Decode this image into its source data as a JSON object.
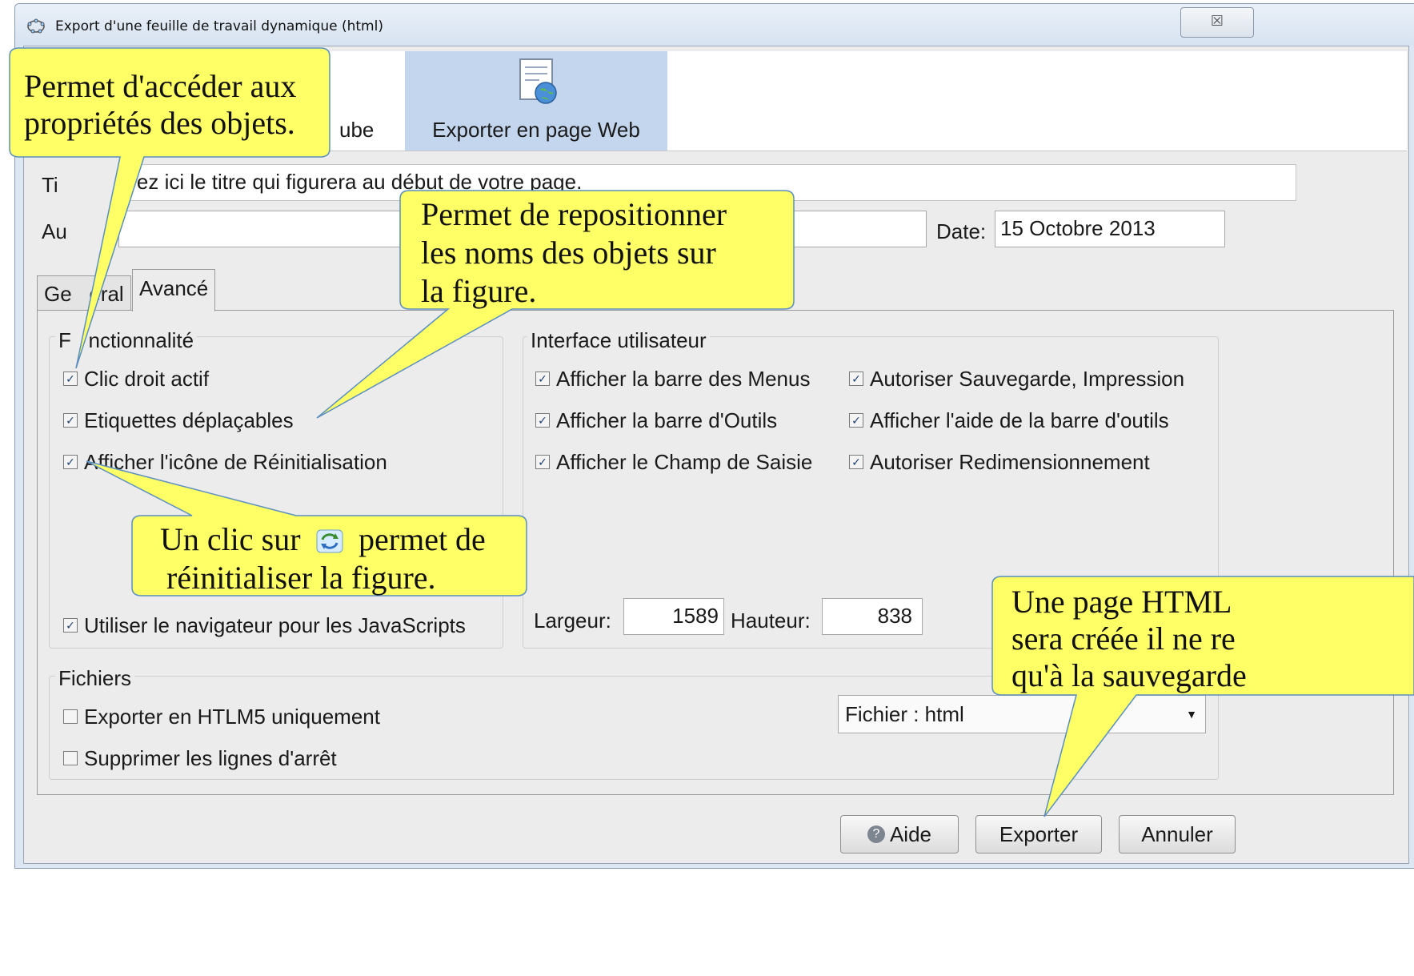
{
  "window": {
    "title": "Export d'une feuille de travail dynamique (html)",
    "close_symbol": "☒"
  },
  "typebar": {
    "tab_youtube_label": "ube",
    "tab_web_label": "Exporter en page Web"
  },
  "form": {
    "title_label": "Ti",
    "title_value": "trez ici le titre qui figurera au début de votre page.",
    "author_label": "Au",
    "author_value": "",
    "date_label": "Date:",
    "date_value": "15 Octobre 2013"
  },
  "tabs": {
    "general": "Ge   eral",
    "advanced": "Avancé"
  },
  "fonctionnalite": {
    "title": "F   nctionnalité",
    "items": [
      {
        "label": "Clic droit actif",
        "checked": true
      },
      {
        "label": "Etiquettes déplaçables",
        "checked": true
      },
      {
        "label": "Afficher l'icône de Réinitialisation",
        "checked": true
      },
      {
        "label": "Utiliser le navigateur pour les JavaScripts",
        "checked": true
      }
    ]
  },
  "interface": {
    "title": "Interface utilisateur",
    "items": [
      {
        "label": "Afficher la barre des Menus",
        "checked": true
      },
      {
        "label": "Autoriser Sauvegarde, Impression",
        "checked": true
      },
      {
        "label": "Afficher la barre d'Outils",
        "checked": true
      },
      {
        "label": "Afficher l'aide de la barre d'outils",
        "checked": true
      },
      {
        "label": "Afficher le Champ de Saisie",
        "checked": true
      },
      {
        "label": "Autoriser Redimensionnement",
        "checked": true
      }
    ],
    "width_label": "Largeur:",
    "width_value": "1589",
    "height_label": "Hauteur:",
    "height_value": "838"
  },
  "fichiers": {
    "title": "Fichiers",
    "items": [
      {
        "label": "Exporter en HTLM5 uniquement",
        "checked": false
      },
      {
        "label": "Supprimer les lignes d'arrêt",
        "checked": false
      }
    ],
    "select_value": "Fichier : html"
  },
  "buttons": {
    "help": "Aide",
    "export": "Exporter",
    "cancel": "Annuler"
  },
  "callouts": {
    "c1_line1": "Permet d'accéder aux",
    "c1_line2": "propriétés des objets.",
    "c2_line1": "Permet de repositionner",
    "c2_line2": "les noms des objets sur",
    "c2_line3": "la figure.",
    "c3_line1a": "Un clic sur",
    "c3_line1b": "permet de",
    "c3_line2": "réinitialiser la figure.",
    "c4_line1": "Une page HTML",
    "c4_line2": "sera créée il ne re",
    "c4_line3": "qu'à la sauvegarde"
  },
  "colors": {
    "callout_fill": "#ffff66",
    "callout_stroke": "#5b8fbf",
    "selected_tab": "#c3d6ee"
  }
}
